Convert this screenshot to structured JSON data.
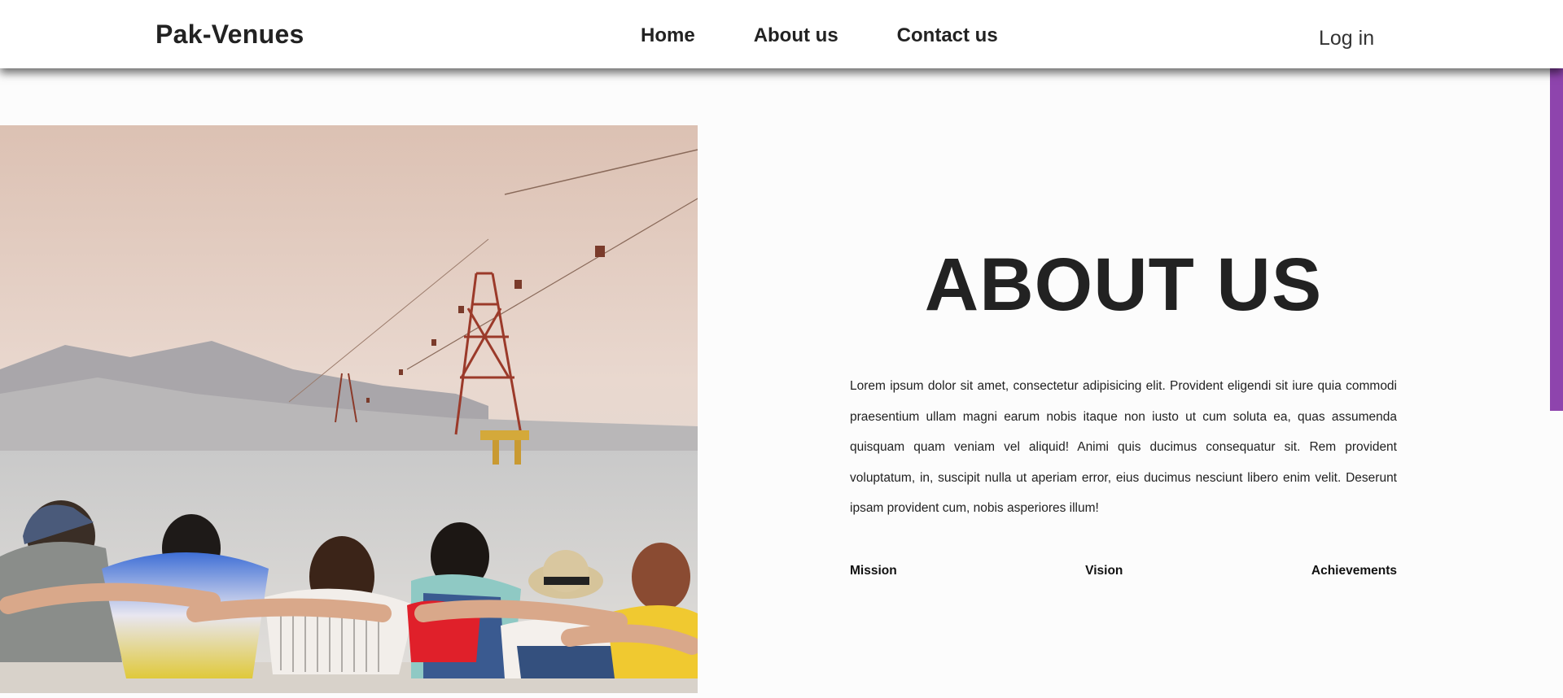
{
  "navbar": {
    "brand": "Pak-Venues",
    "links": [
      {
        "label": "Home"
      },
      {
        "label": "About us"
      },
      {
        "label": "Contact us"
      }
    ],
    "login_label": "Log in"
  },
  "about": {
    "title": "ABOUT US",
    "body": "Lorem ipsum dolor sit amet, consectetur adipisicing elit. Provident eligendi sit iure quia commodi praesentium ullam magni earum nobis itaque non iusto ut cum soluta ea, quas assumenda quisquam quam veniam vel aliquid! Animi quis ducimus consequatur sit. Rem provident voluptatum, in, suscipit nulla ut aperiam error, eius ducimus nesciunt libero enim velit. Deserunt ipsam provident cum, nobis asperiores illum!",
    "tabs": [
      {
        "label": "Mission"
      },
      {
        "label": "Vision"
      },
      {
        "label": "Achievements"
      }
    ]
  },
  "colors": {
    "accent": "#8e44ad",
    "background": "#fcfcfc",
    "text": "#222222"
  }
}
